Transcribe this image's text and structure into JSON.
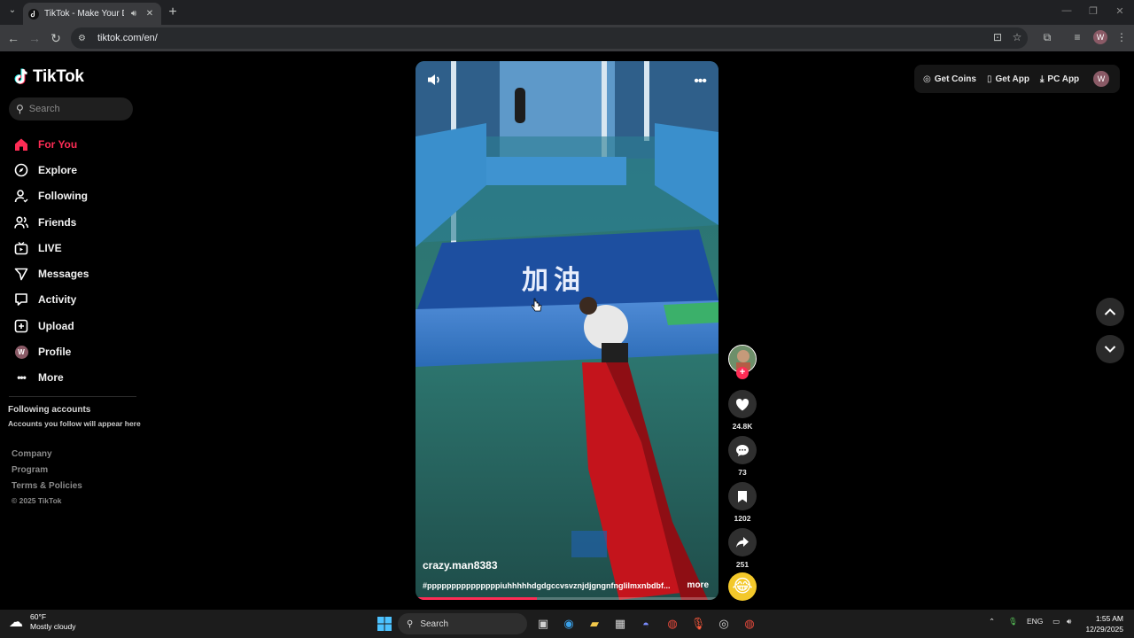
{
  "browser": {
    "tab_title": "TikTok - Make Your Day",
    "url": "tiktok.com/en/",
    "profile_initial": "W"
  },
  "brand": {
    "name": "TikTok"
  },
  "search": {
    "placeholder": "Search"
  },
  "sidebar": {
    "items": [
      {
        "label": "For You",
        "icon": "home-icon",
        "active": true
      },
      {
        "label": "Explore",
        "icon": "compass-icon"
      },
      {
        "label": "Following",
        "icon": "following-icon"
      },
      {
        "label": "Friends",
        "icon": "friends-icon"
      },
      {
        "label": "LIVE",
        "icon": "live-icon"
      },
      {
        "label": "Messages",
        "icon": "messages-icon"
      },
      {
        "label": "Activity",
        "icon": "activity-icon"
      },
      {
        "label": "Upload",
        "icon": "upload-icon"
      },
      {
        "label": "Profile",
        "icon": "profile-avatar",
        "initial": "W"
      },
      {
        "label": "More",
        "icon": "more-icon"
      }
    ],
    "following_title": "Following accounts",
    "following_subtitle": "Accounts you follow will appear here",
    "footer_links": [
      "Company",
      "Program",
      "Terms & Policies"
    ],
    "copyright": "© 2025 TikTok"
  },
  "video": {
    "username": "crazy.man8383",
    "caption": "#pppppppppppppppiuhhhhhdgdgccvsvznjdjgngnfnglilmxnbdbf...",
    "more_label": "more",
    "banner_text": "加油",
    "progress": 0.4
  },
  "actions": {
    "likes": "24.8K",
    "comments": "73",
    "saves": "1202",
    "shares": "251"
  },
  "header": {
    "get_coins": "Get Coins",
    "get_app": "Get App",
    "pc_app": "PC App",
    "user_initial": "W"
  },
  "taskbar": {
    "temperature": "60°F",
    "weather": "Mostly cloudy",
    "search_label": "Search",
    "language": "ENG",
    "time": "1:55 AM",
    "date": "12/29/2025"
  },
  "colors": {
    "accent": "#fe2c55",
    "bg": "#000000"
  }
}
